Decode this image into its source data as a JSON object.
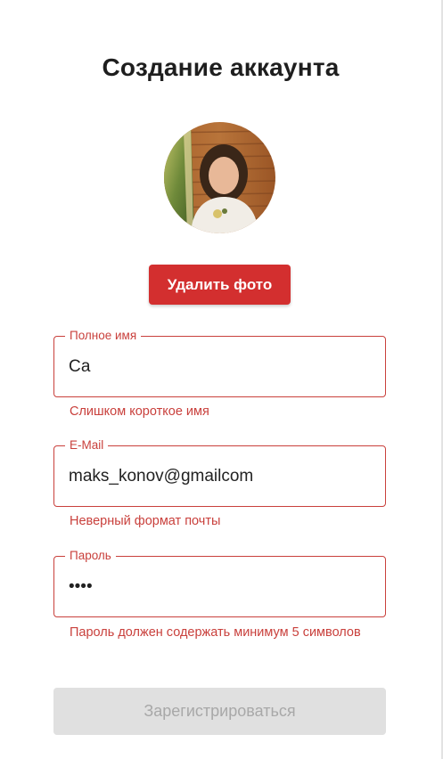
{
  "page": {
    "title": "Создание аккаунта"
  },
  "avatar": {
    "icon": "user-photo"
  },
  "photo": {
    "delete_label": "Удалить фото"
  },
  "form": {
    "full_name": {
      "label": "Полное имя",
      "value": "Са",
      "error": "Слишком короткое имя"
    },
    "email": {
      "label": "E-Mail",
      "value": "maks_konov@gmailcom",
      "error": "Неверный формат почты"
    },
    "password": {
      "label": "Пароль",
      "value": "1234",
      "error": "Пароль должен содержать минимум 5 символов"
    },
    "submit_label": "Зарегистрироваться",
    "submit_enabled": false
  },
  "colors": {
    "error": "#c9403c",
    "primary_danger": "#d32f2f",
    "disabled_bg": "#e0e0e0",
    "disabled_text": "#a8a8a8",
    "title": "#1e1e1e"
  }
}
